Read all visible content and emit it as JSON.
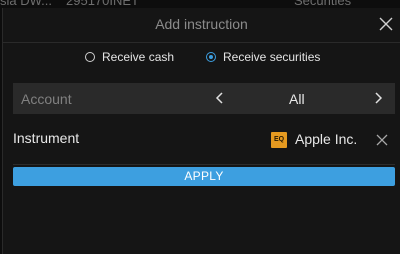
{
  "background": {
    "left_text": "sia DW...",
    "mid_text": "295170INET",
    "right_text": "Securities"
  },
  "dialog": {
    "title": "Add instruction",
    "close_icon": "close-icon",
    "radios": [
      {
        "label": "Receive cash",
        "selected": false
      },
      {
        "label": "Receive securities",
        "selected": true
      }
    ],
    "account": {
      "label": "Account",
      "value": "All",
      "prev_icon": "chevron-left-icon",
      "next_icon": "chevron-right-icon"
    },
    "instrument": {
      "label": "Instrument",
      "badge": "EQ",
      "name": "Apple Inc.",
      "remove_icon": "close-icon"
    },
    "apply_label": "APPLY"
  },
  "colors": {
    "accent": "#3d9fe0",
    "badge": "#e69a20",
    "background": "#151515",
    "field": "#2a2a2a"
  }
}
